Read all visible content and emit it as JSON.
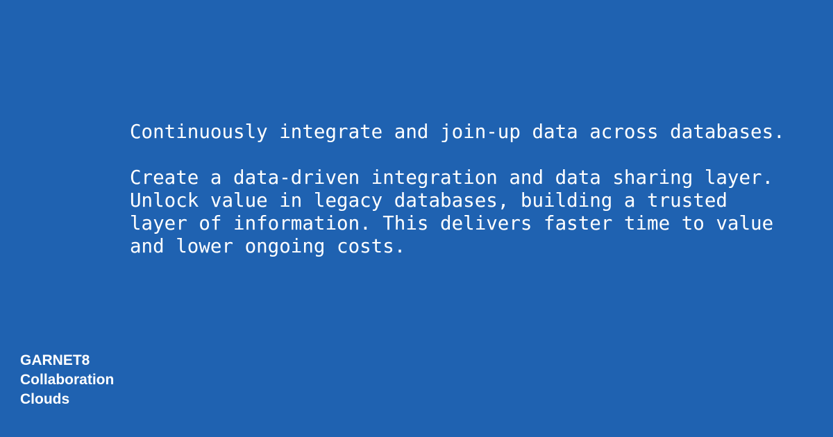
{
  "background_color": "#1f62b1",
  "text_color": "#ffffff",
  "headline": "Continuously integrate and join-up data across databases.",
  "body_lines": [
    "Create a data-driven integration and data sharing layer.",
    "Unlock value in legacy databases, building a trusted",
    "layer of information. This delivers faster time to value",
    "and lower ongoing costs."
  ],
  "brand": {
    "lines": [
      "GARNET8",
      "Collaboration",
      "Clouds"
    ]
  }
}
